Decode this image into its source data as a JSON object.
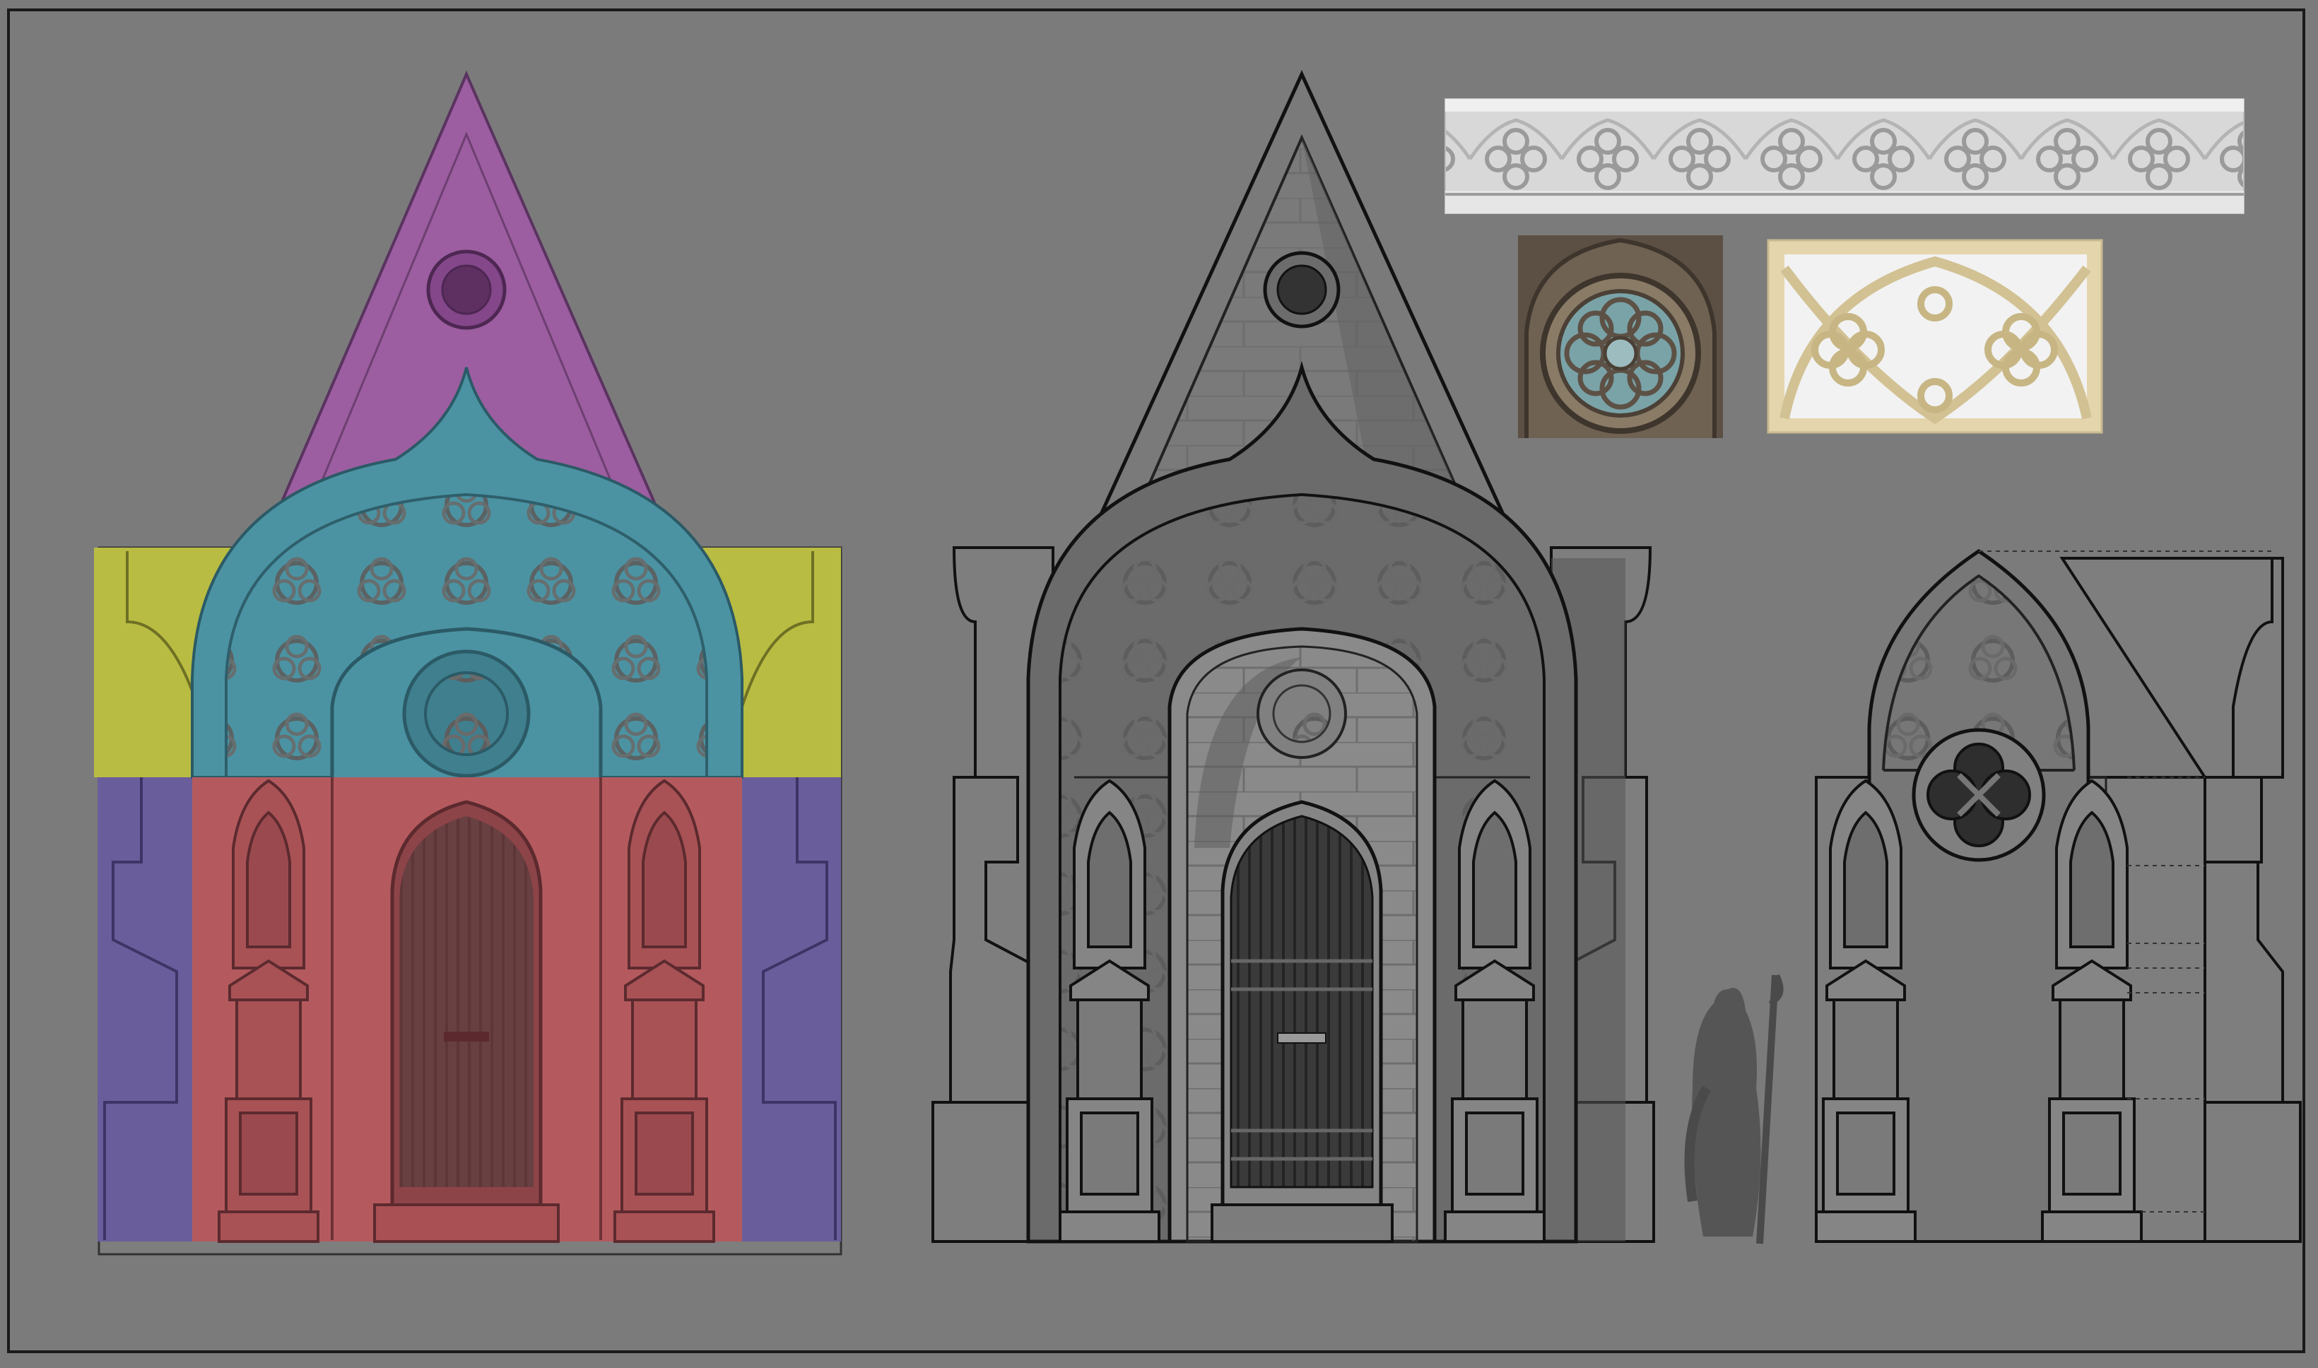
{
  "canvas": {
    "background": "#7b7b7b",
    "frame_color": "#1a1a1a"
  },
  "views": [
    {
      "name": "color-coded-part-breakdown"
    },
    {
      "name": "grayscale-front-elevation"
    },
    {
      "name": "grayscale-side-elevation"
    }
  ],
  "part_colors": {
    "gable": "#9c5ea0",
    "arch_tympanum": "#4b93a3",
    "upper_side_walls": "#b9bc42",
    "lower_side_buttresses": "#6a5d9b",
    "central_portal": "#b45a5e"
  },
  "reference_images": [
    {
      "name": "quatrefoil-frieze-reference",
      "tone": "#dcdcdc"
    },
    {
      "name": "rose-window-reference",
      "tone": "#6f6252"
    },
    {
      "name": "tracery-panel-reference",
      "tone": "#e4d5ad"
    }
  ],
  "scale_figure": {
    "name": "hooded-figure-with-staff",
    "color": "#555555"
  }
}
